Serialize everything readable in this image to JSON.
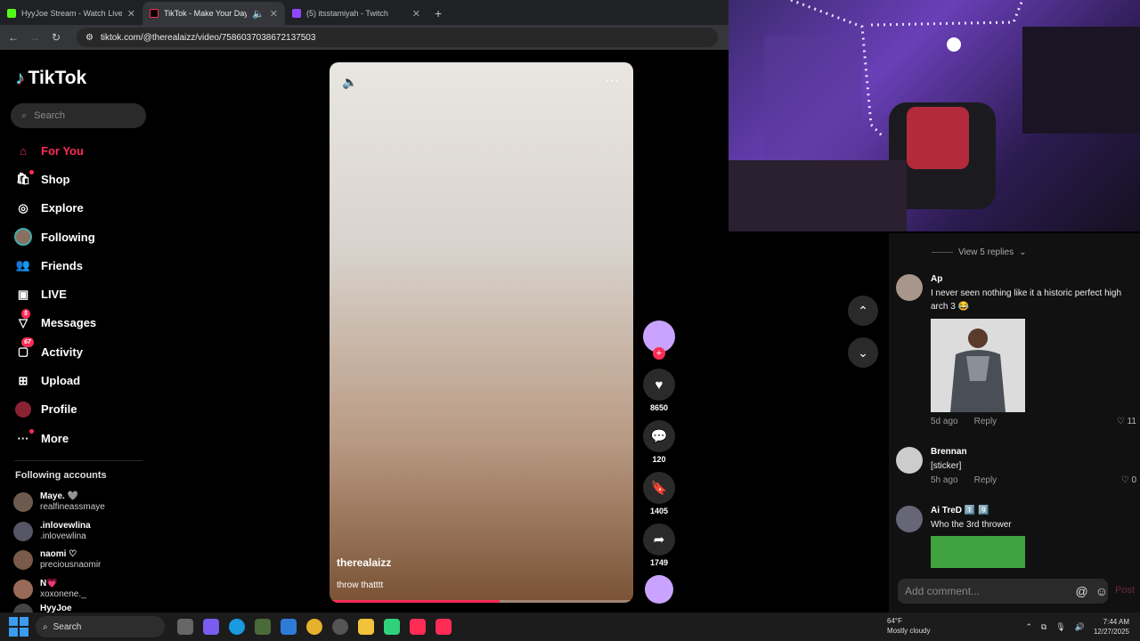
{
  "browser": {
    "tabs": [
      {
        "title": "HyyJoe Stream - Watch Live on",
        "icon": "kick-icon",
        "active": false
      },
      {
        "title": "TikTok - Make Your Day",
        "icon": "tiktok-icon",
        "active": true
      },
      {
        "title": "(5) itsstamiyah - Twitch",
        "icon": "twitch-icon",
        "active": false
      }
    ],
    "new_tab": "+",
    "url": "tiktok.com/@therealaizz/video/7586037038672137503"
  },
  "sidebar": {
    "logo": "TikTok",
    "search_placeholder": "Search",
    "nav": [
      {
        "label": "For You",
        "icon": "home-icon",
        "active": true
      },
      {
        "label": "Shop",
        "icon": "shop-bag-icon"
      },
      {
        "label": "Explore",
        "icon": "compass-icon"
      },
      {
        "label": "Following",
        "icon": "following-avatar-icon"
      },
      {
        "label": "Friends",
        "icon": "friends-icon"
      },
      {
        "label": "LIVE",
        "icon": "live-icon"
      },
      {
        "label": "Messages",
        "icon": "messages-icon",
        "badge": "5"
      },
      {
        "label": "Activity",
        "icon": "activity-icon",
        "badge": "67"
      },
      {
        "label": "Upload",
        "icon": "upload-icon"
      },
      {
        "label": "Profile",
        "icon": "profile-avatar-icon"
      },
      {
        "label": "More",
        "icon": "more-dots-icon"
      }
    ],
    "following_title": "Following accounts",
    "following": [
      {
        "name": "Maye. 🩶",
        "handle": "realfineassmaye"
      },
      {
        "name": ".inlovewlina",
        "handle": ".inlovewlina"
      },
      {
        "name": "naomi ♡",
        "handle": "preciousnaomir"
      },
      {
        "name": "N💗",
        "handle": "xoxonene._"
      },
      {
        "name": "HyyJoe",
        "handle": ""
      }
    ]
  },
  "video": {
    "author": "therealaizz",
    "caption": "throw thatttt",
    "progress": 0.56
  },
  "actions": {
    "likes": "8650",
    "comments": "120",
    "saves": "1405",
    "shares": "1749",
    "follow": "+"
  },
  "comments": {
    "view_replies": "View 5 replies",
    "items": [
      {
        "user": "Ap",
        "text": "I never seen nothing like it a historic perfect high arch 3 😂",
        "time": "5d ago",
        "reply": "Reply",
        "likes": "11"
      },
      {
        "user": "Brennan",
        "text": "[sticker]",
        "time": "5h ago",
        "reply": "Reply",
        "likes": "0"
      },
      {
        "user": "Ai TreD 1️⃣ 9️⃣",
        "text": "Who the 3rd thrower",
        "time": "",
        "reply": "",
        "likes": ""
      }
    ],
    "add_placeholder": "Add comment...",
    "post": "Post"
  },
  "taskbar": {
    "search": "Search",
    "weather_temp": "64°F",
    "weather_desc": "Mostly cloudy",
    "time": "7:44 AM",
    "date": "12/27/2025"
  },
  "colors": {
    "accent": "#fe2c55",
    "background": "#000000"
  }
}
